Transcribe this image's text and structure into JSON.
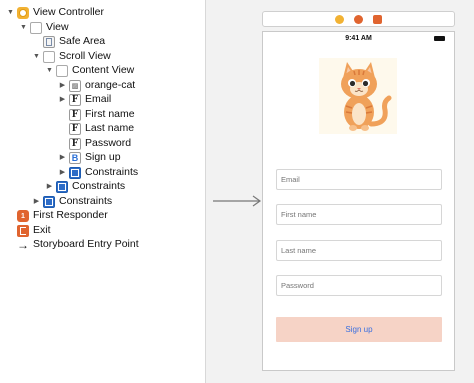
{
  "outline": {
    "items": [
      {
        "label": "View Controller",
        "depth": 0,
        "disclosure": "open",
        "icon": "view-controller-icon"
      },
      {
        "label": "View",
        "depth": 1,
        "disclosure": "open",
        "icon": "view-icon"
      },
      {
        "label": "Safe Area",
        "depth": 2,
        "disclosure": "none",
        "icon": "safe-area-icon"
      },
      {
        "label": "Scroll View",
        "depth": 2,
        "disclosure": "open",
        "icon": "view-icon"
      },
      {
        "label": "Content View",
        "depth": 3,
        "disclosure": "open",
        "icon": "view-icon"
      },
      {
        "label": "orange-cat",
        "depth": 4,
        "disclosure": "closed",
        "icon": "image-view-icon"
      },
      {
        "label": "Email",
        "depth": 4,
        "disclosure": "closed",
        "icon": "text-field-icon"
      },
      {
        "label": "First name",
        "depth": 4,
        "disclosure": "none",
        "icon": "text-field-icon"
      },
      {
        "label": "Last name",
        "depth": 4,
        "disclosure": "none",
        "icon": "text-field-icon"
      },
      {
        "label": "Password",
        "depth": 4,
        "disclosure": "none",
        "icon": "text-field-icon"
      },
      {
        "label": "Sign up",
        "depth": 4,
        "disclosure": "closed",
        "icon": "button-icon"
      },
      {
        "label": "Constraints",
        "depth": 4,
        "disclosure": "closed",
        "icon": "constraints-icon"
      },
      {
        "label": "Constraints",
        "depth": 3,
        "disclosure": "closed",
        "icon": "constraints-icon"
      },
      {
        "label": "Constraints",
        "depth": 2,
        "disclosure": "closed",
        "icon": "constraints-icon"
      },
      {
        "label": "First Responder",
        "depth": 0,
        "disclosure": "none",
        "icon": "first-responder-icon"
      },
      {
        "label": "Exit",
        "depth": 0,
        "disclosure": "none",
        "icon": "exit-icon"
      },
      {
        "label": "Storyboard Entry Point",
        "depth": 0,
        "disclosure": "none",
        "icon": "entry-point-arrow-icon"
      }
    ]
  },
  "icon_glyphs": {
    "text-field-icon": "F",
    "button-icon": "B",
    "image-view-icon": "▨",
    "first-responder-icon": "1",
    "entry-point-arrow-icon": "→"
  },
  "scene_bar": {
    "icons": [
      "view-controller-icon",
      "first-responder-icon",
      "exit-icon"
    ]
  },
  "phone": {
    "time": "9:41 AM",
    "fields": [
      {
        "placeholder": "Email"
      },
      {
        "placeholder": "First name"
      },
      {
        "placeholder": "Last name"
      },
      {
        "placeholder": "Password"
      }
    ],
    "button_label": "Sign up"
  },
  "colors": {
    "accent_blue": "#3a6fe0",
    "button_bg": "#f6d3c6",
    "view_controller_yellow": "#f2b233",
    "orange": "#e0642f",
    "cat_orange": "#f0a15a"
  }
}
